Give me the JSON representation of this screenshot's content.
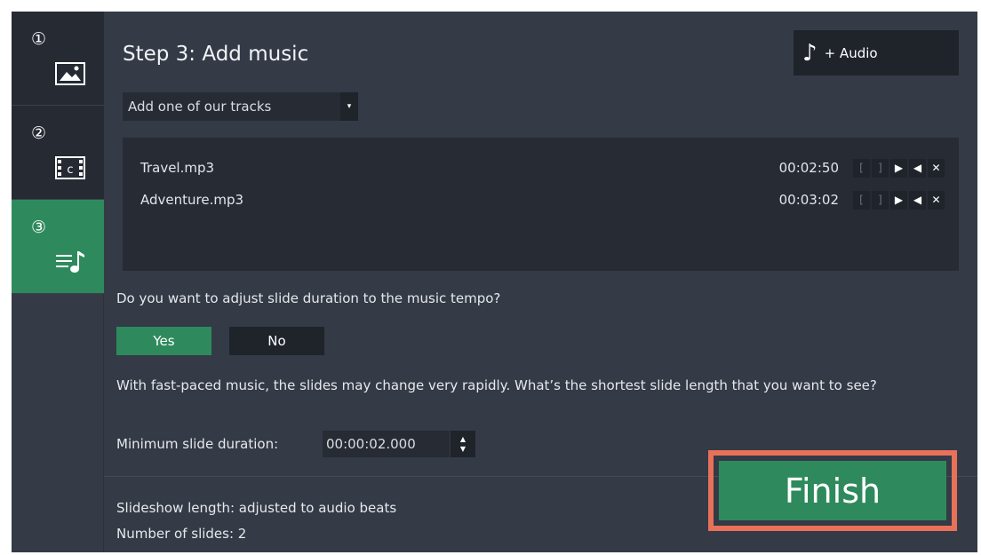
{
  "steps": [
    {
      "number": "①",
      "icon": "image-icon",
      "state": "inactive"
    },
    {
      "number": "②",
      "icon": "film-icon",
      "state": "inactive"
    },
    {
      "number": "③",
      "icon": "music-list-icon",
      "state": "active"
    }
  ],
  "header": {
    "title": "Step 3: Add music",
    "audio_button_label": "+ Audio",
    "audio_icon": "♪"
  },
  "track_source": {
    "selected": "Add one of our tracks",
    "arrow": "▾"
  },
  "tracks": [
    {
      "name": "Travel.mp3",
      "duration": "00:02:50"
    },
    {
      "name": "Adventure.mp3",
      "duration": "00:03:02"
    }
  ],
  "track_controls": {
    "mark_in": "[",
    "mark_out": "]",
    "play": "▶",
    "volume": "◀",
    "remove": "✕"
  },
  "tempo": {
    "question": "Do you want to adjust slide duration to the music tempo?",
    "yes_label": "Yes",
    "no_label": "No",
    "selected": "Yes"
  },
  "info_text": "With fast-paced music, the slides may change very rapidly. What’s the shortest slide length that you want to see?",
  "min_duration": {
    "label": "Minimum slide duration:",
    "value": "00:00:02.000",
    "up": "▲",
    "down": "▼"
  },
  "summary": {
    "length": "Slideshow length: adjusted to audio beats",
    "slides": "Number of slides: 2"
  },
  "finish_label": "Finish",
  "colors": {
    "accent_green": "#2e8a5d",
    "panel": "#343a46",
    "dark": "#1f232a",
    "highlight": "#e8715a"
  }
}
